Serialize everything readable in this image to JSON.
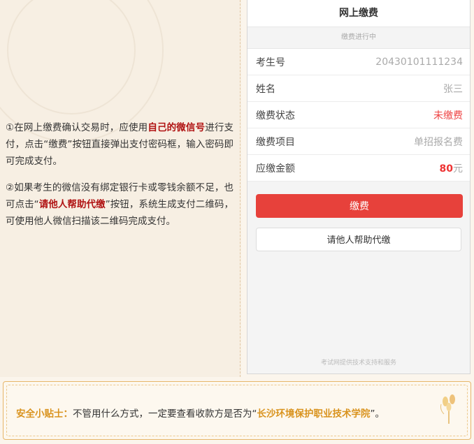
{
  "instructions": {
    "p1_prefix": "①在网上缴费确认交易时，应使用",
    "p1_emph": "自己的微信号",
    "p1_suffix": "进行支付，点击“缴费”按钮直接弹出支付密码框，输入密码即可完成支付。",
    "p2_prefix": "②如果考生的微信没有绑定银行卡或零钱余额不足，也可点击“",
    "p2_emph": "请他人帮助代缴",
    "p2_suffix": "”按钮，系统生成支付二维码，可使用他人微信扫描该二维码完成支付。"
  },
  "phone": {
    "title": "网上缴费",
    "status": "缴费进行中",
    "rows": [
      {
        "label": "考生号",
        "value": "20430101111234"
      },
      {
        "label": "姓名",
        "value": "张三"
      },
      {
        "label": "缴费状态",
        "value": "未缴费"
      },
      {
        "label": "缴费项目",
        "value": "单招报名费"
      },
      {
        "label": "应缴金额",
        "amount": "80",
        "unit": "元"
      }
    ],
    "pay_button": "缴费",
    "help_button": "请他人帮助代缴",
    "footer": "考试网提供技术支持和服务"
  },
  "tip": {
    "label": "安全小贴士：",
    "text": "不管用什么方式，一定要查看收款方是否为“",
    "emph": "长沙环境保护职业技术学院",
    "end": "”。"
  },
  "colors": {
    "accent_red": "#b01212",
    "pay_button": "#e7413b",
    "tip_gold": "#d9931e"
  }
}
